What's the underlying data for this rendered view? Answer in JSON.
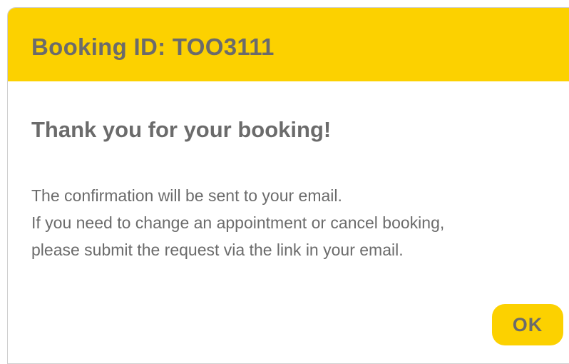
{
  "dialog": {
    "header_title": "Booking ID: TOO3111",
    "heading": "Thank you for your booking!",
    "message_lines": [
      "The confirmation will be sent to your email.",
      "If you need to change an appointment or cancel booking,",
      "please submit the request via the link in your email."
    ],
    "ok_label": "OK"
  },
  "colors": {
    "accent": "#fcd100",
    "text": "#6b6b6b",
    "background": "#ffffff"
  }
}
